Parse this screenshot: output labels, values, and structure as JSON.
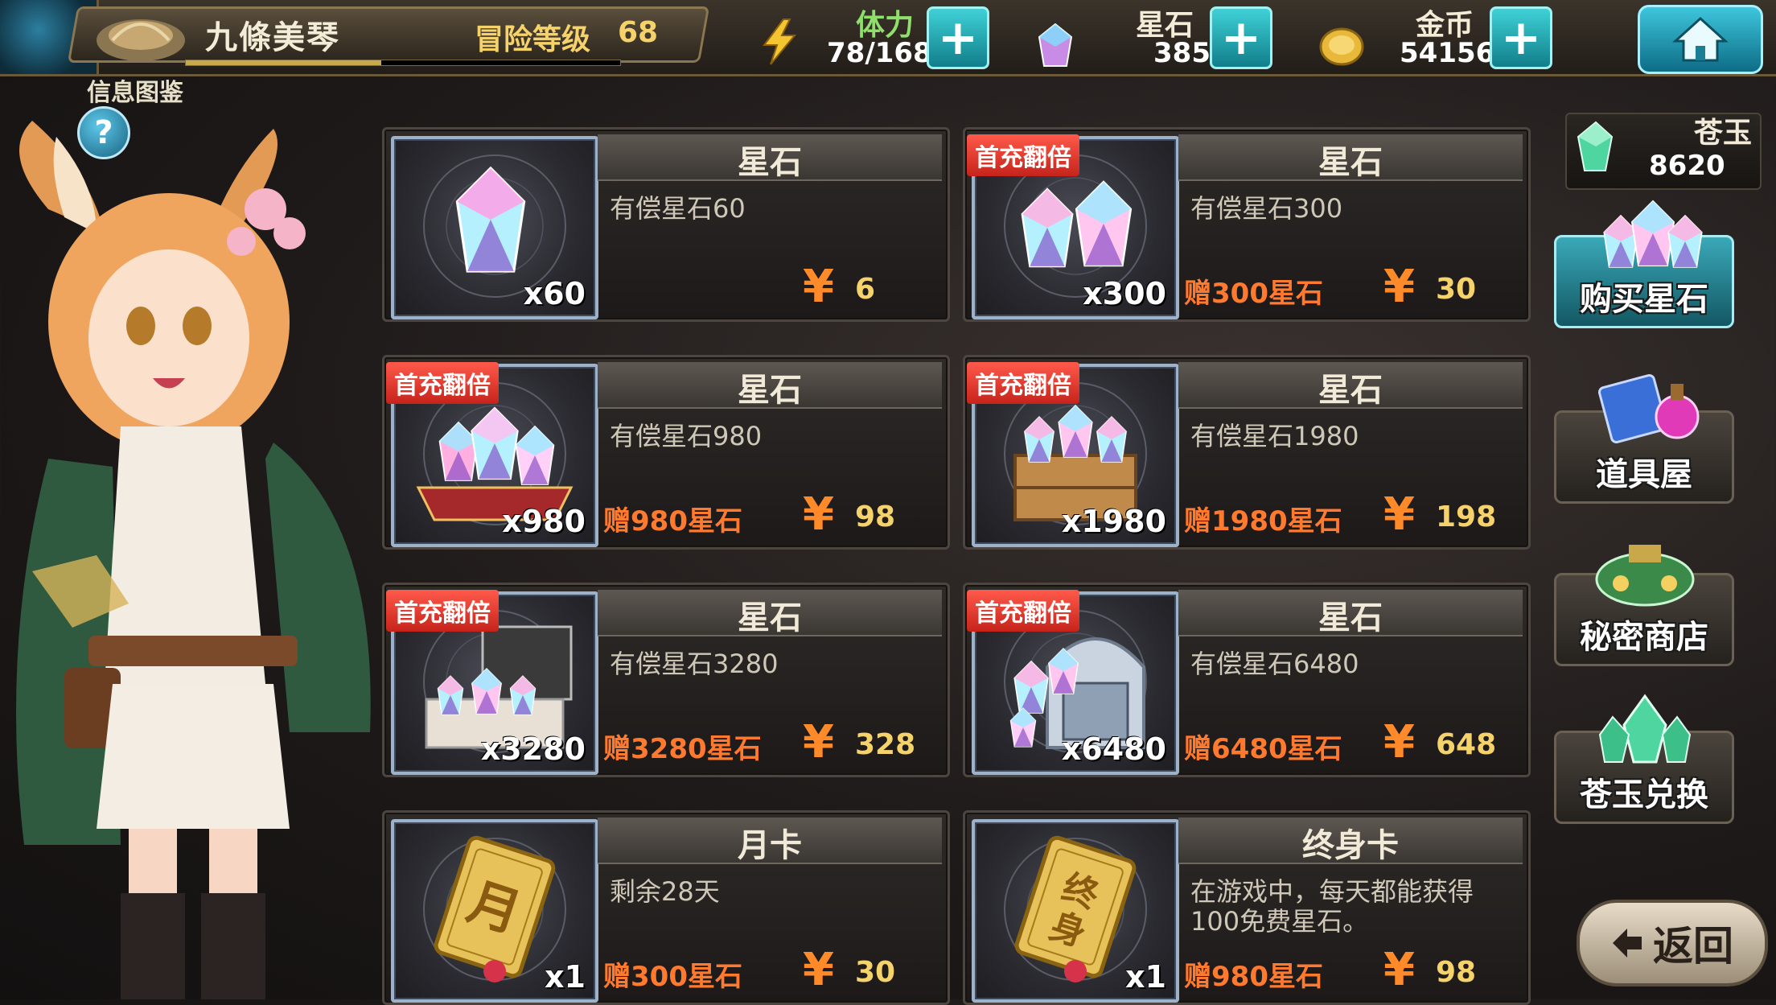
{
  "header": {
    "player_name": "九條美琴",
    "level_label": "冒险等级",
    "level_value": "68",
    "exp_fraction": 0.45,
    "info_label": "信息图鉴",
    "help_label": "?",
    "stamina": {
      "label": "体力",
      "value": "78/168"
    },
    "gems": {
      "label": "星石",
      "value": "385"
    },
    "coins": {
      "label": "金币",
      "value": "54156"
    },
    "plus": "+"
  },
  "side": {
    "jade_label": "苍玉",
    "jade_value": "8620",
    "buttons": [
      {
        "label": "购买星石",
        "icon": "gem-pile-icon",
        "active": true
      },
      {
        "label": "道具屋",
        "icon": "potion-book-icon",
        "active": false
      },
      {
        "label": "秘密商店",
        "icon": "treasure-bag-icon",
        "active": false
      },
      {
        "label": "苍玉兑换",
        "icon": "jade-crystal-icon",
        "active": false
      }
    ],
    "back_label": "返回"
  },
  "cards": [
    {
      "title": "星石",
      "badge": "",
      "qty": "x60",
      "desc": "有偿星石60",
      "bonus": "",
      "yen": "¥",
      "price": "6",
      "thumb": "single-gem"
    },
    {
      "title": "星石",
      "badge": "首充翻倍",
      "qty": "x300",
      "desc": "有偿星石300",
      "bonus": "赠300星石",
      "yen": "¥",
      "price": "30",
      "thumb": "two-gems"
    },
    {
      "title": "星石",
      "badge": "首充翻倍",
      "qty": "x980",
      "desc": "有偿星石980",
      "bonus": "赠980星石",
      "yen": "¥",
      "price": "98",
      "thumb": "gem-cushion"
    },
    {
      "title": "星石",
      "badge": "首充翻倍",
      "qty": "x1980",
      "desc": "有偿星石1980",
      "bonus": "赠1980星石",
      "yen": "¥",
      "price": "198",
      "thumb": "gem-crate"
    },
    {
      "title": "星石",
      "badge": "首充翻倍",
      "qty": "x3280",
      "desc": "有偿星石3280",
      "bonus": "赠3280星石",
      "yen": "¥",
      "price": "328",
      "thumb": "gem-box"
    },
    {
      "title": "星石",
      "badge": "首充翻倍",
      "qty": "x6480",
      "desc": "有偿星石6480",
      "bonus": "赠6480星石",
      "yen": "¥",
      "price": "648",
      "thumb": "gem-chest"
    },
    {
      "title": "月卡",
      "badge": "",
      "qty": "x1",
      "desc": "剩余28天",
      "bonus": "赠300星石",
      "yen": "¥",
      "price": "30",
      "thumb": "month-card",
      "card_char": "月"
    },
    {
      "title": "终身卡",
      "badge": "",
      "qty": "x1",
      "desc": "在游戏中，每天都能获得100免费星石。",
      "bonus": "赠980星石",
      "yen": "¥",
      "price": "98",
      "thumb": "life-card",
      "card_char": "终身"
    }
  ]
}
